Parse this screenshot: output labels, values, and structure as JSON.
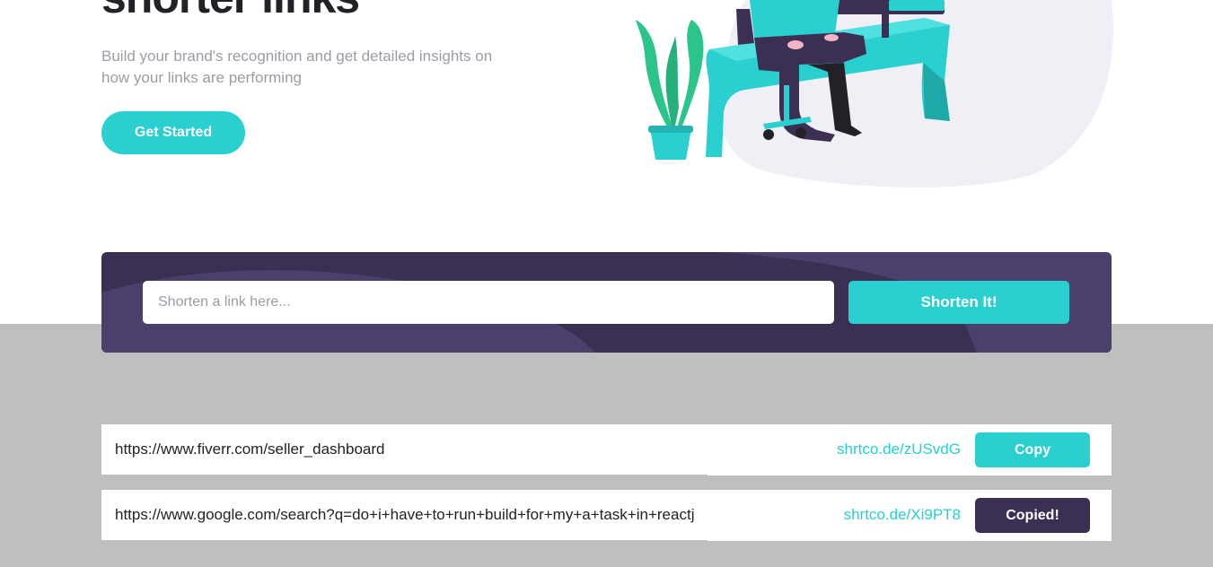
{
  "hero": {
    "title": "shorter links",
    "subtitle": "Build your brand's recognition and get detailed insights on how your links are performing",
    "cta_label": "Get Started"
  },
  "shorten": {
    "placeholder": "Shorten a link here...",
    "button_label": "Shorten It!"
  },
  "results": [
    {
      "original": "https://www.fiverr.com/seller_dashboard",
      "short": "shrtco.de/zUSvdG",
      "button_label": "Copy"
    },
    {
      "original": "https://www.google.com/search?q=do+i+have+to+run+build+for+my+a+task+in+reactjs",
      "short": "shrtco.de/Xi9PT8",
      "button_label": "Copied!"
    }
  ],
  "colors": {
    "cyan": "#2acfcf",
    "dark_violet": "#3b3054",
    "overlay_gray": "#bfbfbf"
  }
}
